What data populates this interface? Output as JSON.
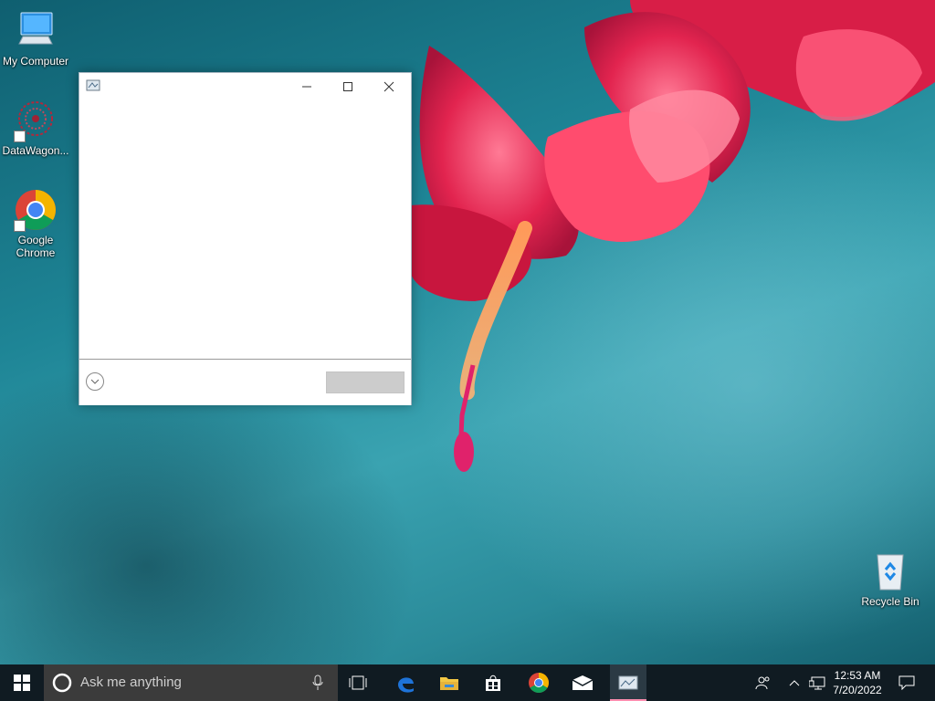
{
  "desktop": {
    "icons": [
      {
        "label": "My Computer",
        "icon": "computer-icon"
      },
      {
        "label": "DataWagon...",
        "icon": "datawagon-icon",
        "shortcut": true
      },
      {
        "label": "Google Chrome",
        "icon": "chrome-icon",
        "shortcut": true
      },
      {
        "label": "Recycle Bin",
        "icon": "recycle-bin-icon"
      }
    ]
  },
  "dialog": {
    "title": "",
    "action_button_label": ""
  },
  "taskbar": {
    "search_placeholder": "Ask me anything",
    "pinned": [
      "task-view",
      "edge",
      "file-explorer",
      "store",
      "chrome",
      "mail",
      "app"
    ],
    "clock_time": "12:53 AM",
    "clock_date": "7/20/2022"
  },
  "colors": {
    "taskbar": "#101b22",
    "search_box": "#3b3b3b",
    "active_indicator": "#ff8fb0",
    "edge_blue": "#1e73d8"
  }
}
